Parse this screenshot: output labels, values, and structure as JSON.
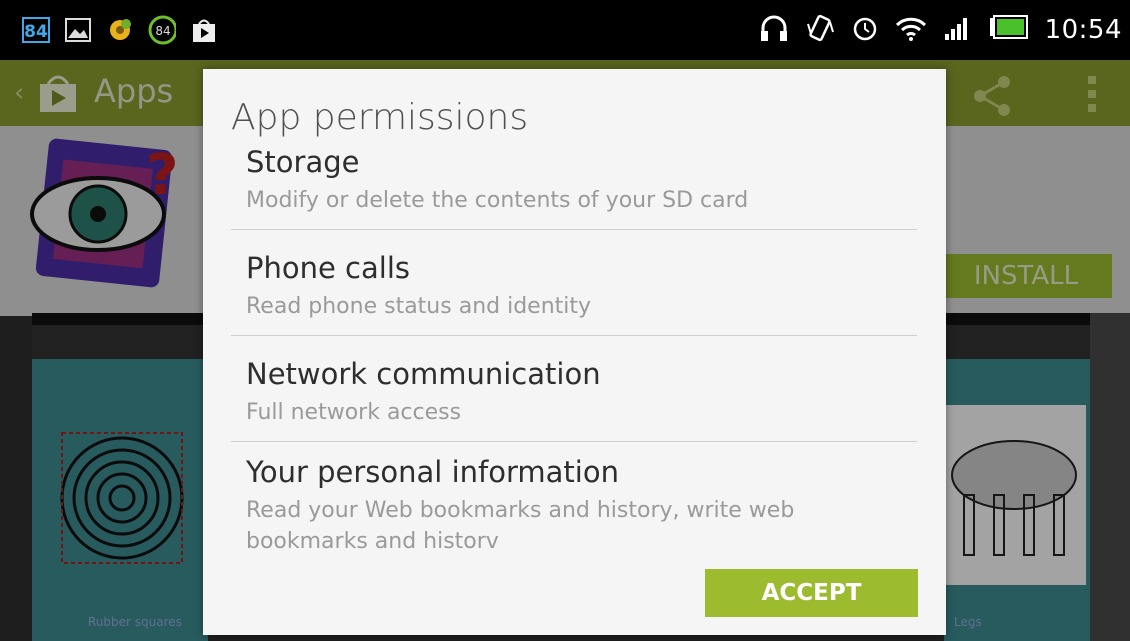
{
  "status_bar": {
    "badge_count": "84",
    "battery_circle": "84",
    "time": "10:54"
  },
  "action_bar": {
    "title": "Apps"
  },
  "background": {
    "install_label": "INSTALL",
    "screenshot_captions": [
      "Rubber squares",
      "Legs"
    ]
  },
  "dialog": {
    "title": "App permissions",
    "permissions": [
      {
        "name": "Storage",
        "description": "Modify or delete the contents of your SD card"
      },
      {
        "name": "Phone calls",
        "description": "Read phone status and identity"
      },
      {
        "name": "Network communication",
        "description": "Full network access"
      },
      {
        "name": "Your personal information",
        "description": "Read your Web bookmarks and history, write web bookmarks and historv"
      }
    ],
    "accept_label": "ACCEPT"
  },
  "colors": {
    "accent": "#9dbb2f",
    "action_bar": "#8a9b2e",
    "badge_blue": "#40a8e8"
  },
  "icons": [
    "image-icon",
    "gear-icon",
    "download-icon",
    "play-store-icon",
    "headphones-icon",
    "vibrate-icon",
    "alarm-icon",
    "wifi-icon",
    "signal-icon",
    "battery-icon",
    "share-icon",
    "overflow-icon"
  ]
}
